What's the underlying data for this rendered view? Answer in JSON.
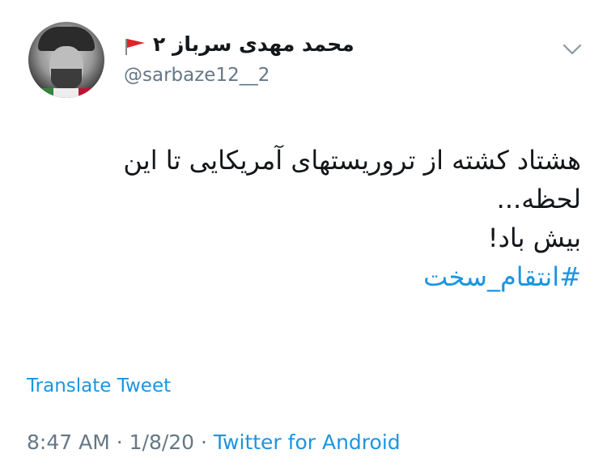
{
  "author": {
    "display_name": "محمد مهدی سرباز ۲",
    "handle": "@sarbaze12__2"
  },
  "tweet": {
    "line1": "هشتاد کشته از تروریستهای آمریکایی تا این",
    "line2": "لحظه...",
    "line3": "بیش باد!",
    "hashtag": "#انتقام_سخت"
  },
  "translate_label": "Translate Tweet",
  "meta": {
    "time": "8:47 AM",
    "sep1": " · ",
    "date": "1/8/20",
    "sep2": " · ",
    "source": "Twitter for Android"
  },
  "colors": {
    "link": "#1b95e0",
    "secondary_text": "#657786",
    "flag_red": "#e0242a"
  },
  "icons": [
    "avatar",
    "red-flag-icon",
    "chevron-down-icon"
  ]
}
